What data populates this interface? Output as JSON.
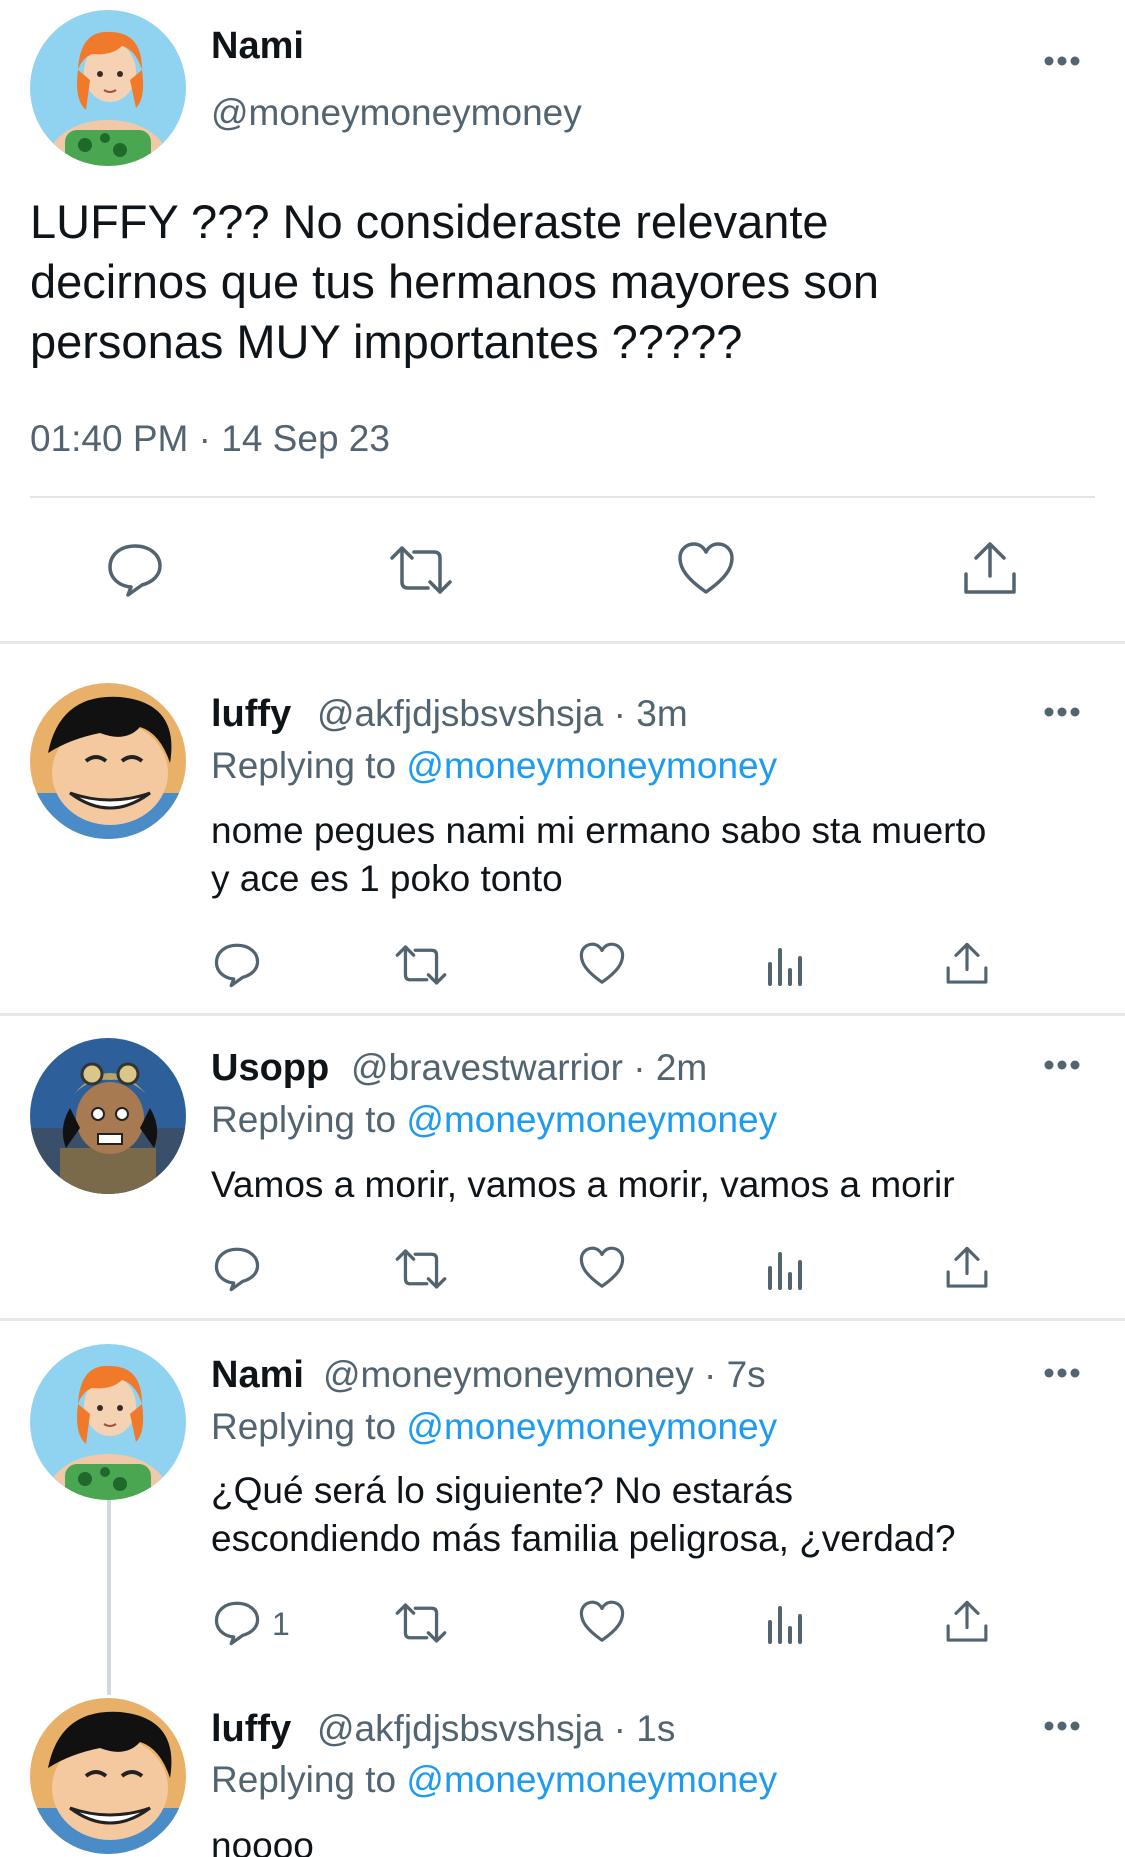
{
  "main_tweet": {
    "name": "Nami",
    "handle": "@moneymoneymoney",
    "text": "LUFFY ??? No consideraste relevante\ndecirnos que tus hermanos mayores son\npersonas MUY importantes ?????",
    "timestamp": "01:40 PM · 14 Sep 23",
    "actions": [
      "reply-icon",
      "retweet-icon",
      "like-icon",
      "share-icon"
    ]
  },
  "replies": [
    {
      "name": "luffy",
      "meta": "@akfjdjsbsvshsja · 3m",
      "replying_prefix": "Replying to",
      "replying_to": "@moneymoneymoney",
      "text": "nome pegues nami mi ermano sabo sta muerto\ny ace es 1 poko tonto",
      "reply_count": ""
    },
    {
      "name": "Usopp",
      "meta": "@bravestwarrior · 2m",
      "replying_prefix": "Replying to",
      "replying_to": "@moneymoneymoney",
      "text": "Vamos a morir, vamos a morir, vamos a morir",
      "reply_count": ""
    },
    {
      "name": "Nami",
      "meta": "@moneymoneymoney · 7s",
      "replying_prefix": "Replying to",
      "replying_to": "@moneymoneymoney",
      "text": "¿Qué será lo siguiente? No estarás\nescondiendo más familia peligrosa, ¿verdad?",
      "reply_count": "1"
    },
    {
      "name": "luffy",
      "meta": "@akfjdjsbsvshsja · 1s",
      "replying_prefix": "Replying to",
      "replying_to": "@moneymoneymoney",
      "text": "noooo",
      "reply_count": ""
    }
  ],
  "colors": {
    "text": "#0f1419",
    "secondary": "#536471",
    "link": "#1d9bf0",
    "divider": "#e6e9ec"
  }
}
